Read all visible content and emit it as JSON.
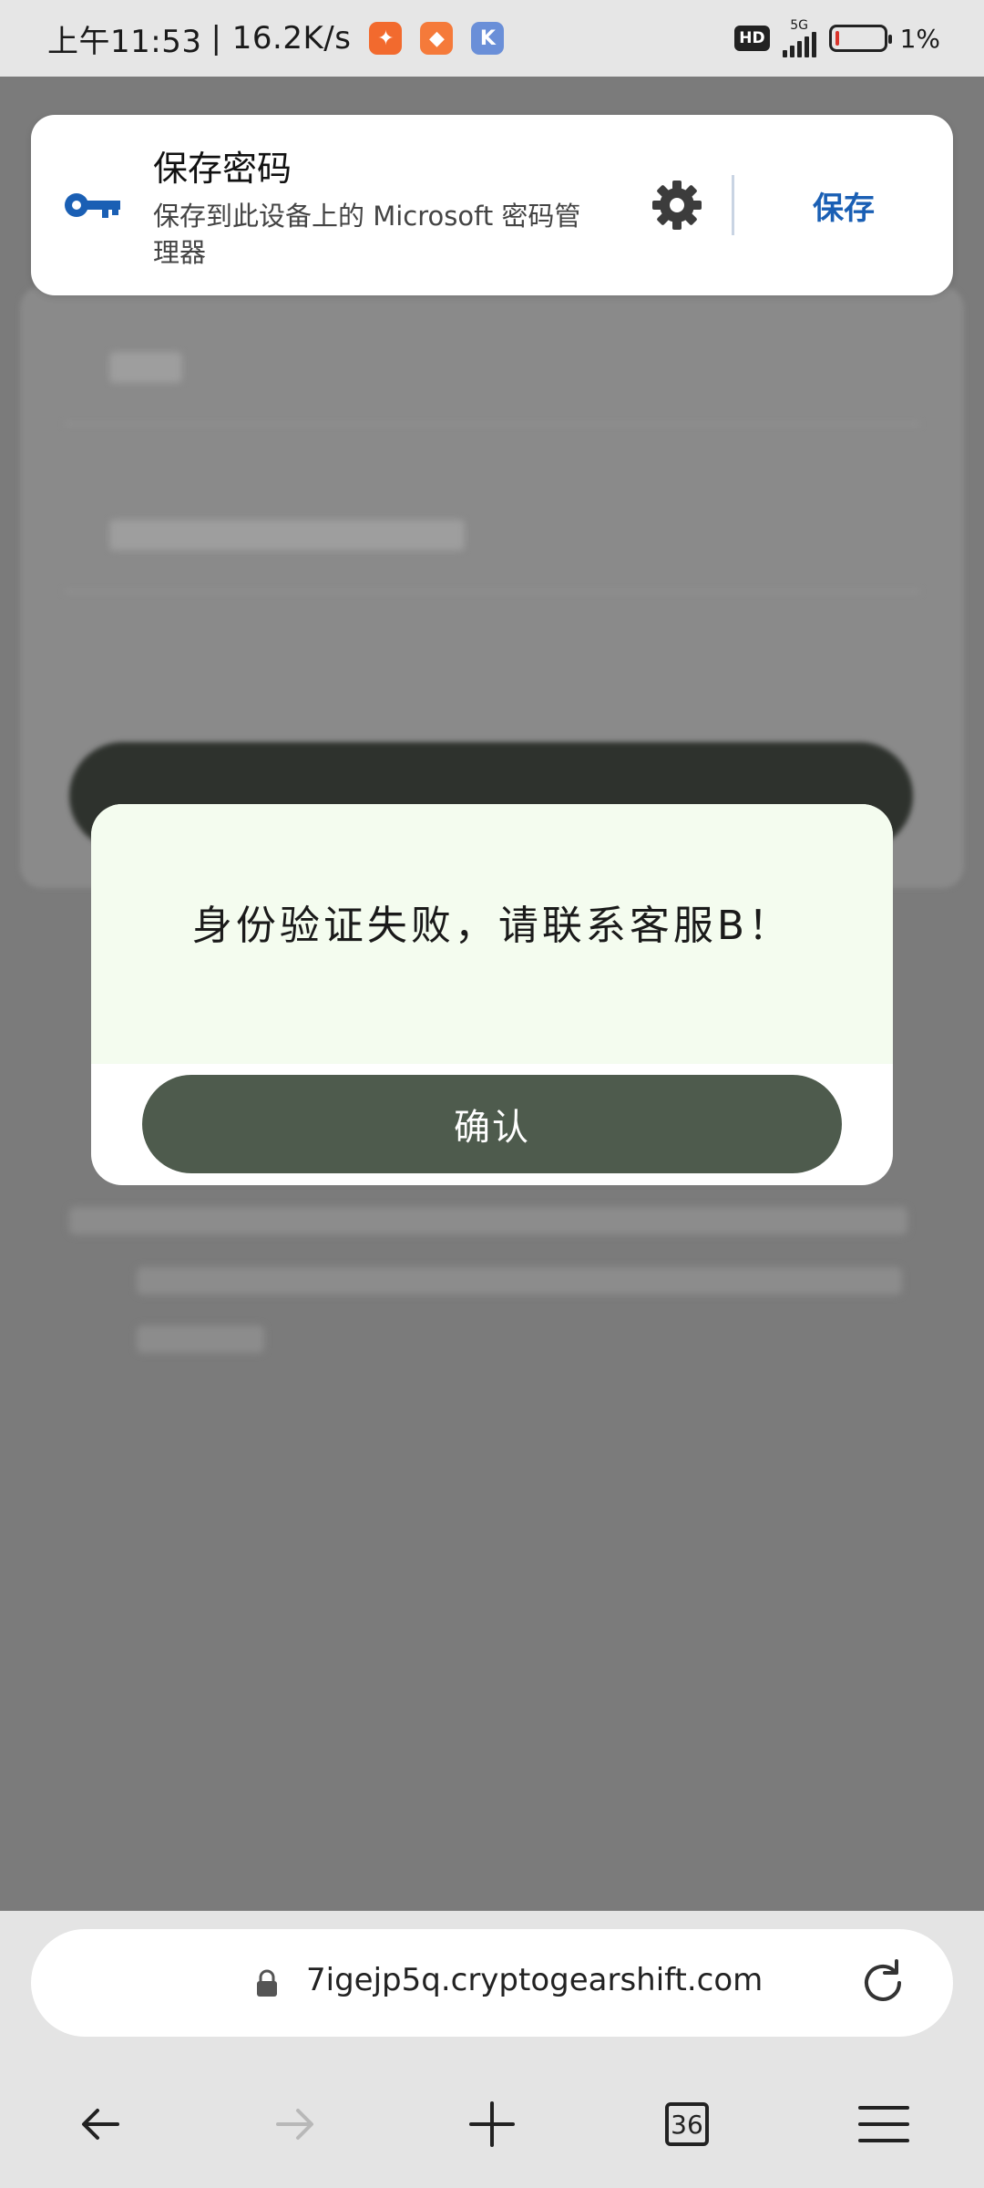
{
  "status_bar": {
    "time": "上午11:53",
    "speed": "| 16.2K/s",
    "hd": "HD",
    "network": "5G",
    "battery": "1%"
  },
  "save_password": {
    "title": "保存密码",
    "subtitle": "保存到此设备上的 Microsoft 密码管理器",
    "save_label": "保存"
  },
  "dialog": {
    "message": "身份验证失败，请联系客服B！",
    "confirm_label": "确认"
  },
  "browser": {
    "url": "7igejp5q.cryptogearshift.com",
    "tab_count": "36"
  },
  "colors": {
    "accent_blue": "#1a5fb4",
    "dialog_button": "#4e5b4d",
    "dialog_message_bg": "#f4fcef"
  }
}
